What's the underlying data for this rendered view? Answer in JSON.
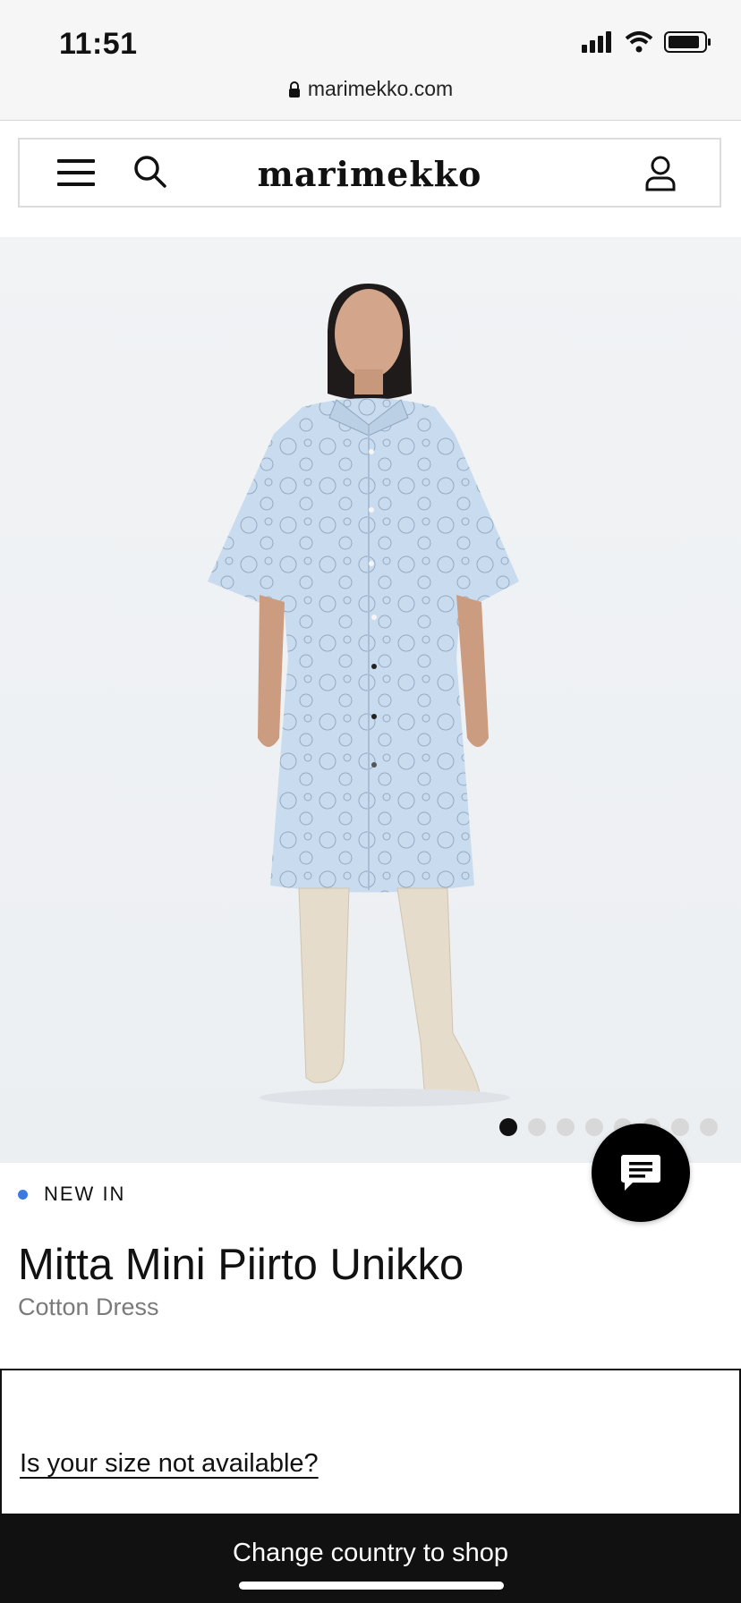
{
  "status": {
    "time": "11:51"
  },
  "browser": {
    "url": "marimekko.com"
  },
  "header": {
    "logo": "marimekko"
  },
  "product": {
    "badge": "NEW IN",
    "title": "Mitta Mini Piirto Unikko",
    "subtitle": "Cotton Dress",
    "size_link": "Is your size not available?"
  },
  "carousel": {
    "count": 8,
    "active": 1
  },
  "footer": {
    "cta": "Change country to shop"
  },
  "colors": {
    "accent": "#3d7ae0",
    "dress": "#c9dbee",
    "boots": "#e6dccb"
  }
}
